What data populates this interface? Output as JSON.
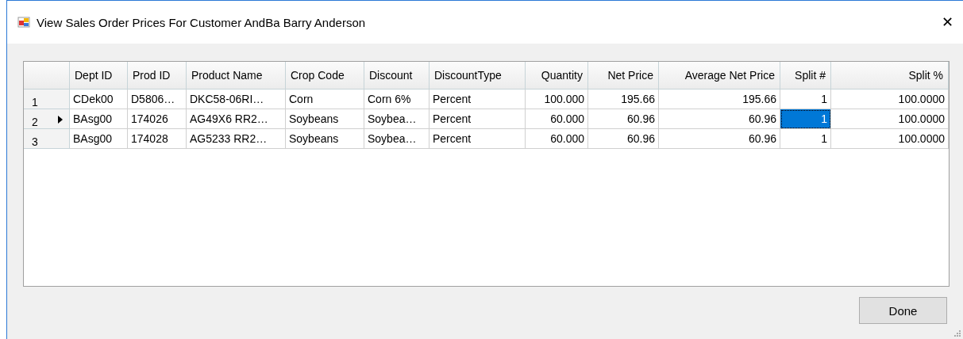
{
  "window": {
    "title": "View Sales Order Prices For Customer AndBa Barry Anderson",
    "close": "✕"
  },
  "grid": {
    "columns": [
      {
        "label": "Dept ID",
        "right_aligned": false
      },
      {
        "label": "Prod ID",
        "right_aligned": false
      },
      {
        "label": "Product Name",
        "right_aligned": false
      },
      {
        "label": "Crop Code",
        "right_aligned": false
      },
      {
        "label": "Discount",
        "right_aligned": false
      },
      {
        "label": "DiscountType",
        "right_aligned": false
      },
      {
        "label": "Quantity",
        "right_aligned": true
      },
      {
        "label": "Net Price",
        "right_aligned": true
      },
      {
        "label": "Average Net Price",
        "right_aligned": true
      },
      {
        "label": "Split #",
        "right_aligned": true
      },
      {
        "label": "Split %",
        "right_aligned": true
      }
    ],
    "rows": [
      {
        "number": "1",
        "current": false,
        "cells": [
          {
            "text": "CDek00",
            "selected": false
          },
          {
            "text": "D5806…",
            "selected": false
          },
          {
            "text": "DKC58-06RI…",
            "selected": false
          },
          {
            "text": "Corn",
            "selected": false
          },
          {
            "text": "Corn 6%",
            "selected": false
          },
          {
            "text": "Percent",
            "selected": false
          },
          {
            "text": "100.000",
            "selected": false
          },
          {
            "text": "195.66",
            "selected": false
          },
          {
            "text": "195.66",
            "selected": false
          },
          {
            "text": "1",
            "selected": false
          },
          {
            "text": "100.0000",
            "selected": false
          }
        ]
      },
      {
        "number": "2",
        "current": true,
        "cells": [
          {
            "text": "BAsg00",
            "selected": false
          },
          {
            "text": "174026",
            "selected": false
          },
          {
            "text": "AG49X6  RR2…",
            "selected": false
          },
          {
            "text": "Soybeans",
            "selected": false
          },
          {
            "text": "Soybea…",
            "selected": false
          },
          {
            "text": "Percent",
            "selected": false
          },
          {
            "text": "60.000",
            "selected": false
          },
          {
            "text": "60.96",
            "selected": false
          },
          {
            "text": "60.96",
            "selected": false
          },
          {
            "text": "1",
            "selected": true
          },
          {
            "text": "100.0000",
            "selected": false
          }
        ]
      },
      {
        "number": "3",
        "current": false,
        "cells": [
          {
            "text": "BAsg00",
            "selected": false
          },
          {
            "text": "174028",
            "selected": false
          },
          {
            "text": "AG5233  RR2…",
            "selected": false
          },
          {
            "text": "Soybeans",
            "selected": false
          },
          {
            "text": "Soybea…",
            "selected": false
          },
          {
            "text": "Percent",
            "selected": false
          },
          {
            "text": "60.000",
            "selected": false
          },
          {
            "text": "60.96",
            "selected": false
          },
          {
            "text": "60.96",
            "selected": false
          },
          {
            "text": "1",
            "selected": false
          },
          {
            "text": "100.0000",
            "selected": false
          }
        ]
      }
    ]
  },
  "buttons": [
    {
      "label": "Done"
    }
  ]
}
